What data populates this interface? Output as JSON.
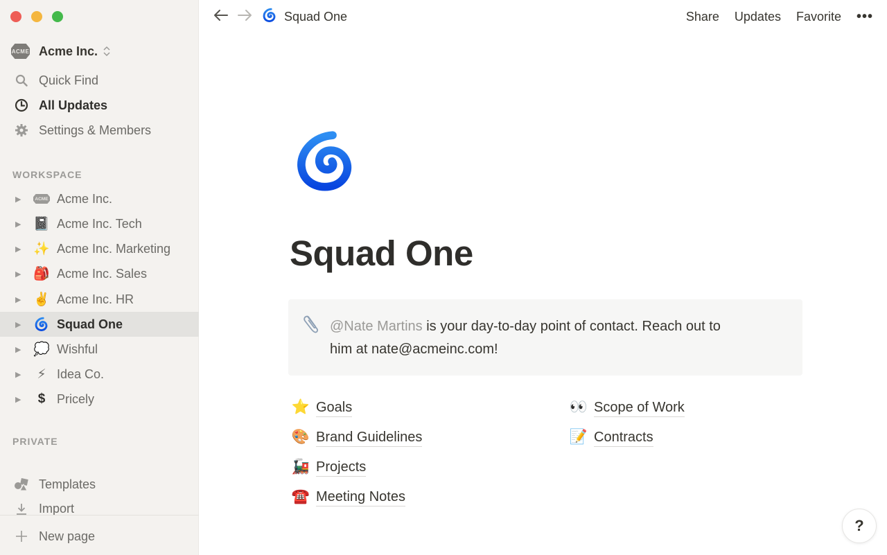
{
  "window": {
    "traffic_lights": {
      "close": "#ee5d56",
      "minimize": "#f4b63f",
      "maximize": "#44b94b"
    }
  },
  "sidebar": {
    "workspace_name": "Acme Inc.",
    "workspace_logo_text": "ACME",
    "nav": [
      {
        "label": "Quick Find",
        "icon": "search-icon"
      },
      {
        "label": "All Updates",
        "icon": "clock-icon"
      },
      {
        "label": "Settings & Members",
        "icon": "gear-icon"
      }
    ],
    "workspace_section_label": "WORKSPACE",
    "workspace_pages": [
      {
        "label": "Acme Inc.",
        "icon": "acme-logo-icon",
        "emoji": "ACME"
      },
      {
        "label": "Acme Inc. Tech",
        "icon": "notebook-icon",
        "emoji": "📓"
      },
      {
        "label": "Acme Inc. Marketing",
        "icon": "sparkles-icon",
        "emoji": "✨"
      },
      {
        "label": "Acme Inc. Sales",
        "icon": "backpack-icon",
        "emoji": "🎒"
      },
      {
        "label": "Acme Inc. HR",
        "icon": "victory-hand-icon",
        "emoji": "✌️"
      },
      {
        "label": "Squad One",
        "icon": "cyclone-icon",
        "emoji": "🌀",
        "selected": true
      },
      {
        "label": "Wishful",
        "icon": "thought-bubble-icon",
        "emoji": "💭"
      },
      {
        "label": "Idea Co.",
        "icon": "lightning-icon",
        "emoji": "⚡"
      },
      {
        "label": "Pricely",
        "icon": "dollar-icon",
        "emoji": "$"
      }
    ],
    "private_section_label": "PRIVATE",
    "footer": [
      {
        "label": "Templates",
        "icon": "templates-icon"
      },
      {
        "label": "Import",
        "icon": "import-icon"
      }
    ],
    "new_page_label": "New page"
  },
  "topbar": {
    "breadcrumb": "Squad One",
    "breadcrumb_emoji": "🌀",
    "actions": {
      "share": "Share",
      "updates": "Updates",
      "favorite": "Favorite",
      "more": "•••"
    }
  },
  "page": {
    "title": "Squad One",
    "icon": "cyclone-icon",
    "callout": {
      "icon": "📎",
      "mention": "@Nate Martins",
      "text_line1": " is your day-to-day point of contact. Reach out to",
      "text_line2": "him at nate@acmeinc.com!"
    },
    "links_left": [
      {
        "emoji": "⭐",
        "label": "Goals"
      },
      {
        "emoji": "🎨",
        "label": "Brand Guidelines"
      },
      {
        "emoji": "🚂",
        "label": "Projects"
      },
      {
        "emoji": "☎️",
        "label": "Meeting Notes"
      }
    ],
    "links_right": [
      {
        "emoji": "👀",
        "label": "Scope of Work"
      },
      {
        "emoji": "📝",
        "label": "Contracts"
      }
    ]
  },
  "help_button": "?"
}
